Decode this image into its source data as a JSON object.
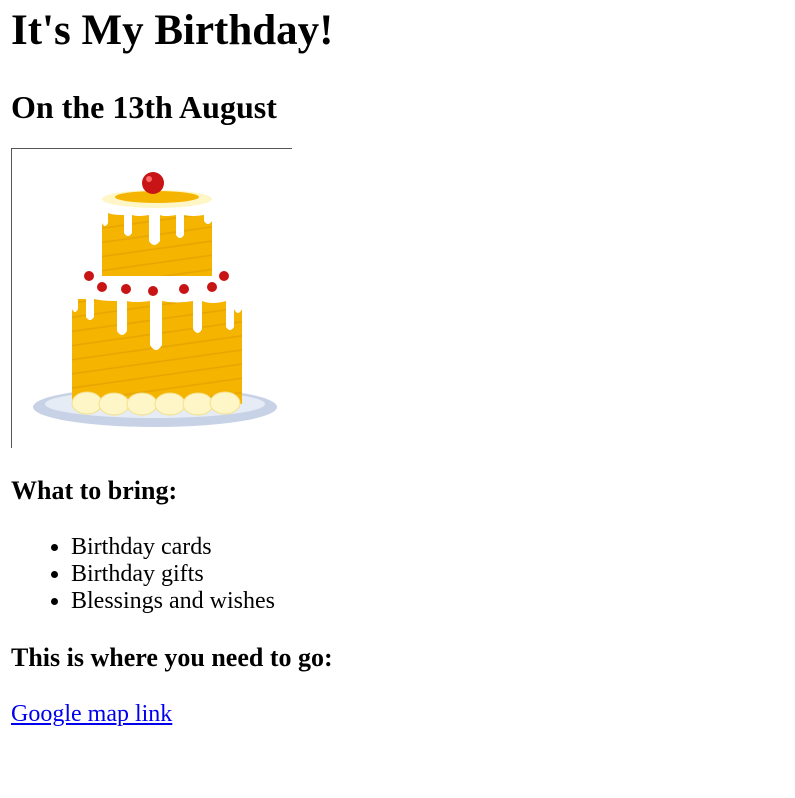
{
  "heading": "It's My Birthday!",
  "subheading": "On the 13th August",
  "image": {
    "icon": "birthday-cake-image",
    "colors": {
      "cake": "#f5b400",
      "icing": "#ffffff",
      "cherry": "#c81414",
      "plate": "#c8d2e6"
    }
  },
  "bring_section": {
    "title": "What to bring:",
    "items": [
      "Birthday cards",
      "Birthday gifts",
      "Blessings and wishes"
    ]
  },
  "location_section": {
    "title": "This is where you need to go:",
    "link_text": "Google map link"
  },
  "colors": {
    "link": "#0000ee",
    "text": "#000000"
  }
}
